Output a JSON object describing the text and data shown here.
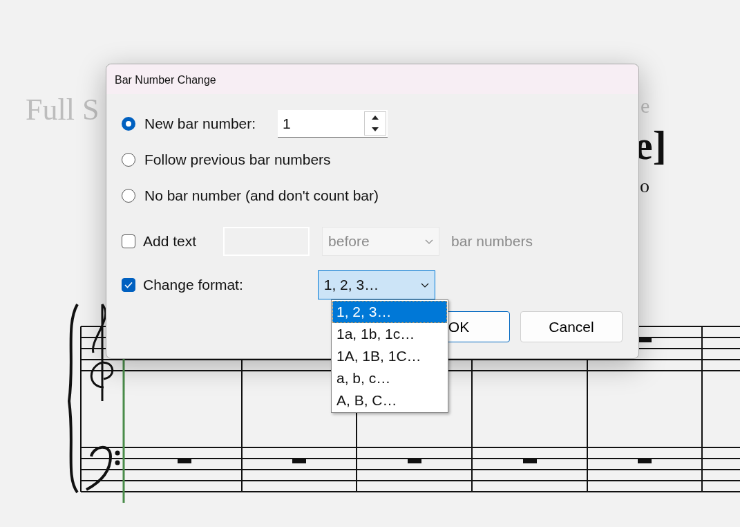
{
  "score": {
    "title_fragment": "Full S",
    "subtitle_fragment": "e",
    "heading_fragment": "e]",
    "composer_fragment": "o"
  },
  "dialog": {
    "title": "Bar Number Change",
    "options": [
      {
        "label": "New bar number:",
        "selected": true
      },
      {
        "label": "Follow previous bar numbers",
        "selected": false
      },
      {
        "label": "No bar number (and don't count bar)",
        "selected": false
      }
    ],
    "bar_number": {
      "value": "1"
    },
    "add_text": {
      "label": "Add text",
      "checked": false,
      "position": "before",
      "suffix": "bar numbers"
    },
    "change_format": {
      "label": "Change format:",
      "checked": true,
      "value": "1, 2, 3…",
      "expanded": true,
      "options": [
        {
          "label": "1, 2, 3…",
          "selected": true
        },
        {
          "label": "1a, 1b, 1c…",
          "selected": false
        },
        {
          "label": "1A, 1B, 1C…",
          "selected": false
        },
        {
          "label": "a, b, c…",
          "selected": false
        },
        {
          "label": "A, B, C…",
          "selected": false
        }
      ]
    },
    "buttons": [
      {
        "label": "OK",
        "default": true
      },
      {
        "label": "Cancel",
        "default": false
      }
    ]
  }
}
